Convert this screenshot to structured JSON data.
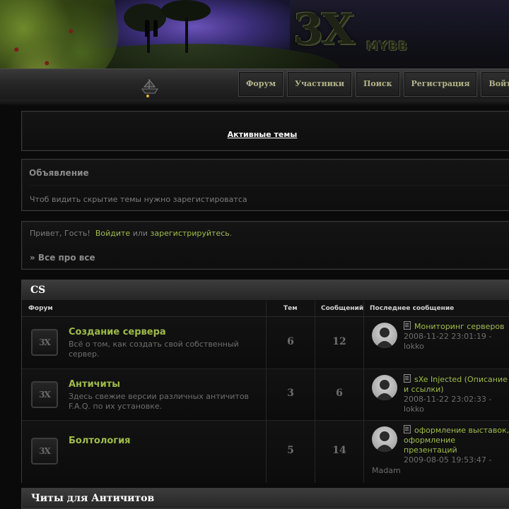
{
  "header": {
    "logo_text": "3X",
    "logo_sub": "MYBB"
  },
  "nav": {
    "items": [
      {
        "label": "Форум"
      },
      {
        "label": "Участники"
      },
      {
        "label": "Поиск"
      },
      {
        "label": "Регистрация"
      },
      {
        "label": "Войти"
      }
    ]
  },
  "active_topics": {
    "label": "Активные темы"
  },
  "announcement": {
    "title": "Объявление",
    "text": "Чтоб видить скрытие темы нужно зарегистироватса"
  },
  "welcome": {
    "greeting": "Привет, Гость!",
    "login_link": "Войдите",
    "or": "или",
    "register_link": "зарегистрируйтесь",
    "period": ".",
    "breadcrumb": "» Все про все"
  },
  "category": {
    "title": "CS",
    "columns": {
      "forum": "Форум",
      "topics": "Тем",
      "posts": "Сообщений",
      "last_post": "Последнее сообщение"
    },
    "forums": [
      {
        "icon_text": "3X",
        "title": "Создание сервера",
        "desc": "Всё о том, как создать свой собственный сервер.",
        "topics": "6",
        "posts": "12",
        "last_title": "Мониторинг серверов",
        "last_date": "2008-11-22 23:01:19 - lokko"
      },
      {
        "icon_text": "3X",
        "title": "Античиты",
        "desc": "Здесь свежие версии различных античитов F.A.Q. по их установке.",
        "topics": "3",
        "posts": "6",
        "last_title": "sXe Injected (Описание и ссылки)",
        "last_date": "2008-11-22 23:02:33 - lokko"
      },
      {
        "icon_text": "3X",
        "title": "Болтология",
        "desc": "",
        "topics": "5",
        "posts": "14",
        "last_title": "оформление выставок, оформление презентаций",
        "last_date": "2009-08-05 19:53:47 -",
        "last_author": "Madam"
      }
    ]
  },
  "category2": {
    "title": "Читы для Античитов"
  }
}
